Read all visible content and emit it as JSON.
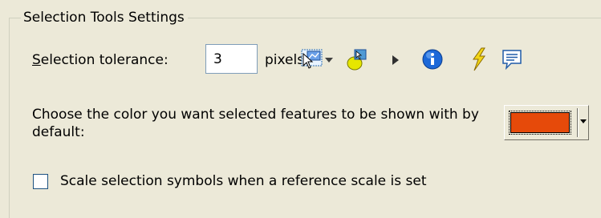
{
  "group": {
    "title": "Selection Tools Settings"
  },
  "tolerance": {
    "label_mnemonic": "S",
    "label_rest": "election tolerance:",
    "value": "3",
    "units": "pixels"
  },
  "toolbar_icons": [
    "select-features-icon",
    "dropdown-arrow-icon",
    "select-elements-icon",
    "arrow-pointer-icon",
    "identify-icon",
    "lightning-icon",
    "comment-icon"
  ],
  "color_setting": {
    "description": "Choose the color you want selected features to be shown with by default:",
    "selected_color": "#e64a0a"
  },
  "scale_symbols": {
    "label": "Scale selection symbols when a reference scale is set",
    "checked": false
  }
}
